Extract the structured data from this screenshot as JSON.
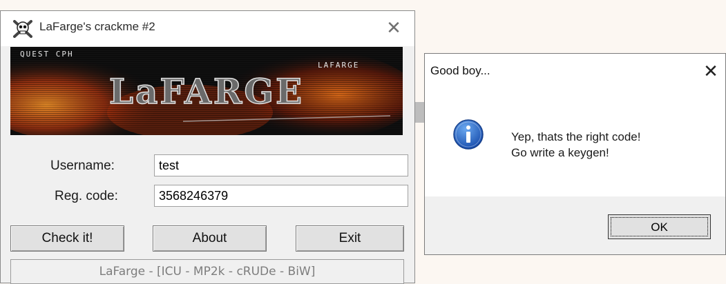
{
  "crackme_window": {
    "title": "LaFarge's crackme #2",
    "close_glyph": "✕",
    "banner": {
      "small_left": "QUEST CPH",
      "small_right": "LAFARGE",
      "logo": "LaFARGE"
    },
    "username_label": "Username:",
    "username_value": "test",
    "regcode_label": "Reg. code:",
    "regcode_value": "3568246379",
    "buttons": {
      "check": "Check it!",
      "about": "About",
      "exit": "Exit"
    },
    "status_text": "LaFarge - [ICU - MP2k - cRUDe - BiW]"
  },
  "message_box": {
    "title": "Good boy...",
    "close_glyph": "✕",
    "line1": "Yep, thats the right code!",
    "line2": "Go write a keygen!",
    "ok_label": "OK",
    "icon": "info-icon"
  },
  "colors": {
    "window_bg": "#f0f0f0",
    "banner_bg": "#101010",
    "banner_fire": "#d0461a",
    "info_icon_blue": "#1f5fc0"
  }
}
